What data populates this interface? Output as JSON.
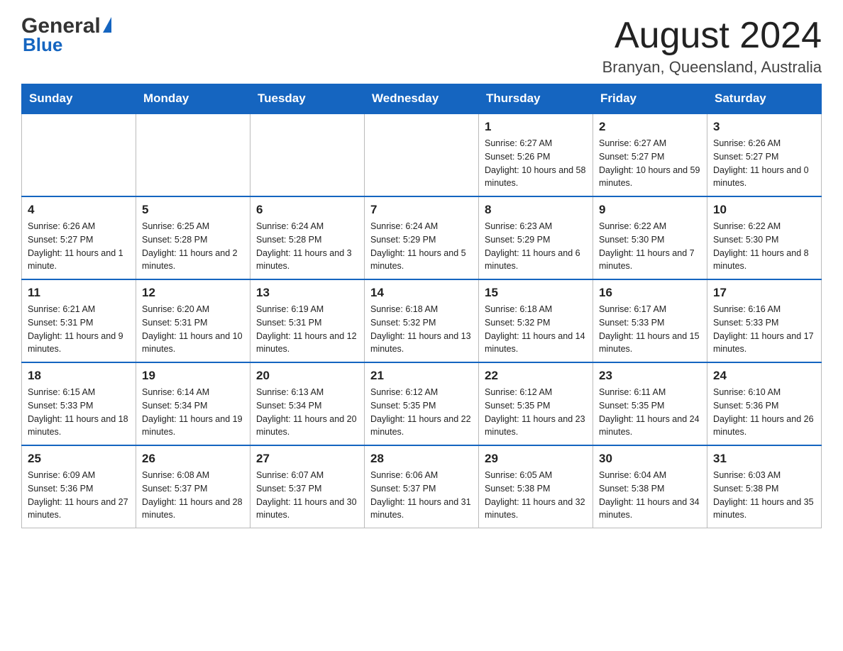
{
  "header": {
    "logo_general": "General",
    "logo_blue": "Blue",
    "month_title": "August 2024",
    "location": "Branyan, Queensland, Australia"
  },
  "weekdays": [
    "Sunday",
    "Monday",
    "Tuesday",
    "Wednesday",
    "Thursday",
    "Friday",
    "Saturday"
  ],
  "weeks": [
    [
      {
        "day": "",
        "sunrise": "",
        "sunset": "",
        "daylight": ""
      },
      {
        "day": "",
        "sunrise": "",
        "sunset": "",
        "daylight": ""
      },
      {
        "day": "",
        "sunrise": "",
        "sunset": "",
        "daylight": ""
      },
      {
        "day": "",
        "sunrise": "",
        "sunset": "",
        "daylight": ""
      },
      {
        "day": "1",
        "sunrise": "Sunrise: 6:27 AM",
        "sunset": "Sunset: 5:26 PM",
        "daylight": "Daylight: 10 hours and 58 minutes."
      },
      {
        "day": "2",
        "sunrise": "Sunrise: 6:27 AM",
        "sunset": "Sunset: 5:27 PM",
        "daylight": "Daylight: 10 hours and 59 minutes."
      },
      {
        "day": "3",
        "sunrise": "Sunrise: 6:26 AM",
        "sunset": "Sunset: 5:27 PM",
        "daylight": "Daylight: 11 hours and 0 minutes."
      }
    ],
    [
      {
        "day": "4",
        "sunrise": "Sunrise: 6:26 AM",
        "sunset": "Sunset: 5:27 PM",
        "daylight": "Daylight: 11 hours and 1 minute."
      },
      {
        "day": "5",
        "sunrise": "Sunrise: 6:25 AM",
        "sunset": "Sunset: 5:28 PM",
        "daylight": "Daylight: 11 hours and 2 minutes."
      },
      {
        "day": "6",
        "sunrise": "Sunrise: 6:24 AM",
        "sunset": "Sunset: 5:28 PM",
        "daylight": "Daylight: 11 hours and 3 minutes."
      },
      {
        "day": "7",
        "sunrise": "Sunrise: 6:24 AM",
        "sunset": "Sunset: 5:29 PM",
        "daylight": "Daylight: 11 hours and 5 minutes."
      },
      {
        "day": "8",
        "sunrise": "Sunrise: 6:23 AM",
        "sunset": "Sunset: 5:29 PM",
        "daylight": "Daylight: 11 hours and 6 minutes."
      },
      {
        "day": "9",
        "sunrise": "Sunrise: 6:22 AM",
        "sunset": "Sunset: 5:30 PM",
        "daylight": "Daylight: 11 hours and 7 minutes."
      },
      {
        "day": "10",
        "sunrise": "Sunrise: 6:22 AM",
        "sunset": "Sunset: 5:30 PM",
        "daylight": "Daylight: 11 hours and 8 minutes."
      }
    ],
    [
      {
        "day": "11",
        "sunrise": "Sunrise: 6:21 AM",
        "sunset": "Sunset: 5:31 PM",
        "daylight": "Daylight: 11 hours and 9 minutes."
      },
      {
        "day": "12",
        "sunrise": "Sunrise: 6:20 AM",
        "sunset": "Sunset: 5:31 PM",
        "daylight": "Daylight: 11 hours and 10 minutes."
      },
      {
        "day": "13",
        "sunrise": "Sunrise: 6:19 AM",
        "sunset": "Sunset: 5:31 PM",
        "daylight": "Daylight: 11 hours and 12 minutes."
      },
      {
        "day": "14",
        "sunrise": "Sunrise: 6:18 AM",
        "sunset": "Sunset: 5:32 PM",
        "daylight": "Daylight: 11 hours and 13 minutes."
      },
      {
        "day": "15",
        "sunrise": "Sunrise: 6:18 AM",
        "sunset": "Sunset: 5:32 PM",
        "daylight": "Daylight: 11 hours and 14 minutes."
      },
      {
        "day": "16",
        "sunrise": "Sunrise: 6:17 AM",
        "sunset": "Sunset: 5:33 PM",
        "daylight": "Daylight: 11 hours and 15 minutes."
      },
      {
        "day": "17",
        "sunrise": "Sunrise: 6:16 AM",
        "sunset": "Sunset: 5:33 PM",
        "daylight": "Daylight: 11 hours and 17 minutes."
      }
    ],
    [
      {
        "day": "18",
        "sunrise": "Sunrise: 6:15 AM",
        "sunset": "Sunset: 5:33 PM",
        "daylight": "Daylight: 11 hours and 18 minutes."
      },
      {
        "day": "19",
        "sunrise": "Sunrise: 6:14 AM",
        "sunset": "Sunset: 5:34 PM",
        "daylight": "Daylight: 11 hours and 19 minutes."
      },
      {
        "day": "20",
        "sunrise": "Sunrise: 6:13 AM",
        "sunset": "Sunset: 5:34 PM",
        "daylight": "Daylight: 11 hours and 20 minutes."
      },
      {
        "day": "21",
        "sunrise": "Sunrise: 6:12 AM",
        "sunset": "Sunset: 5:35 PM",
        "daylight": "Daylight: 11 hours and 22 minutes."
      },
      {
        "day": "22",
        "sunrise": "Sunrise: 6:12 AM",
        "sunset": "Sunset: 5:35 PM",
        "daylight": "Daylight: 11 hours and 23 minutes."
      },
      {
        "day": "23",
        "sunrise": "Sunrise: 6:11 AM",
        "sunset": "Sunset: 5:35 PM",
        "daylight": "Daylight: 11 hours and 24 minutes."
      },
      {
        "day": "24",
        "sunrise": "Sunrise: 6:10 AM",
        "sunset": "Sunset: 5:36 PM",
        "daylight": "Daylight: 11 hours and 26 minutes."
      }
    ],
    [
      {
        "day": "25",
        "sunrise": "Sunrise: 6:09 AM",
        "sunset": "Sunset: 5:36 PM",
        "daylight": "Daylight: 11 hours and 27 minutes."
      },
      {
        "day": "26",
        "sunrise": "Sunrise: 6:08 AM",
        "sunset": "Sunset: 5:37 PM",
        "daylight": "Daylight: 11 hours and 28 minutes."
      },
      {
        "day": "27",
        "sunrise": "Sunrise: 6:07 AM",
        "sunset": "Sunset: 5:37 PM",
        "daylight": "Daylight: 11 hours and 30 minutes."
      },
      {
        "day": "28",
        "sunrise": "Sunrise: 6:06 AM",
        "sunset": "Sunset: 5:37 PM",
        "daylight": "Daylight: 11 hours and 31 minutes."
      },
      {
        "day": "29",
        "sunrise": "Sunrise: 6:05 AM",
        "sunset": "Sunset: 5:38 PM",
        "daylight": "Daylight: 11 hours and 32 minutes."
      },
      {
        "day": "30",
        "sunrise": "Sunrise: 6:04 AM",
        "sunset": "Sunset: 5:38 PM",
        "daylight": "Daylight: 11 hours and 34 minutes."
      },
      {
        "day": "31",
        "sunrise": "Sunrise: 6:03 AM",
        "sunset": "Sunset: 5:38 PM",
        "daylight": "Daylight: 11 hours and 35 minutes."
      }
    ]
  ]
}
